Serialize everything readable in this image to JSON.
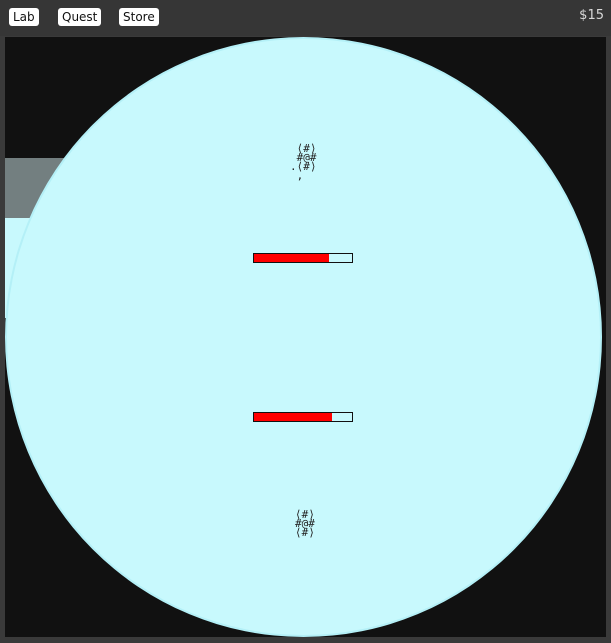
{
  "nav": {
    "lab_label": "Lab",
    "quest_label": "Quest",
    "store_label": "Store"
  },
  "money": "$15",
  "arena": {
    "background_color": "#111111",
    "bubble_color": "#c8f9fd",
    "wall_color": "#737f80",
    "enemy": {
      "glyph": " ⟨#⟩\n #@#\n.⟨#⟩\n ,",
      "hp_fraction": 0.77
    },
    "player": {
      "glyph": "⟨#⟩\n#@#\n⟨#⟩",
      "hp_fraction": 0.8
    }
  }
}
